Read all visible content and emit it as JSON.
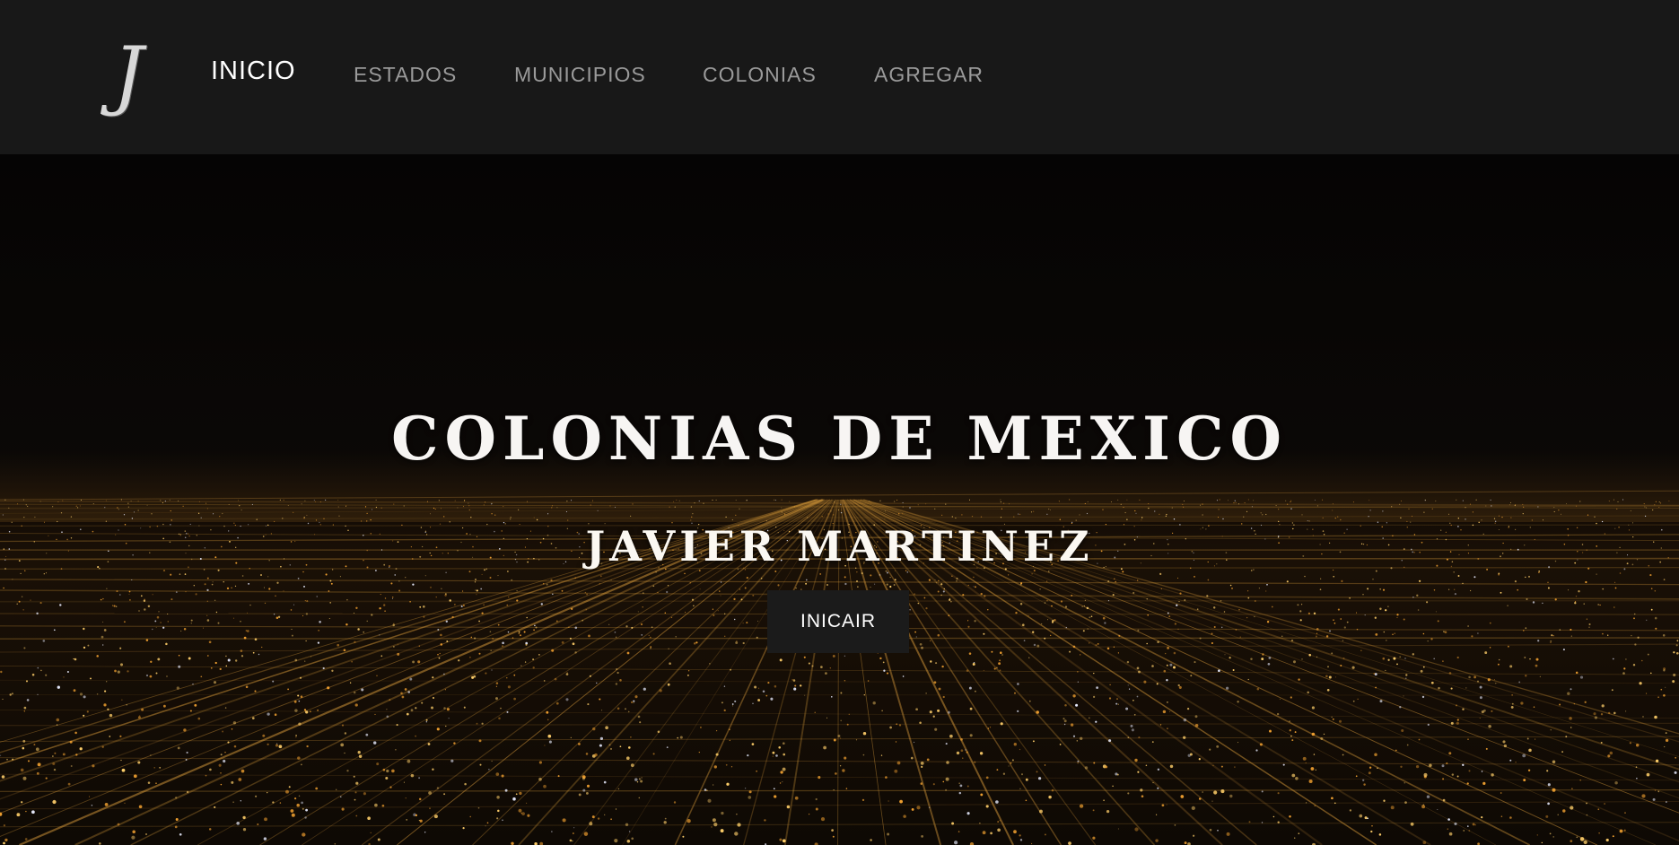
{
  "navbar": {
    "logo_text": "J",
    "items": [
      {
        "label": "INICIO",
        "active": true
      },
      {
        "label": "ESTADOS",
        "active": false
      },
      {
        "label": "MUNICIPIOS",
        "active": false
      },
      {
        "label": "COLONIAS",
        "active": false
      },
      {
        "label": "AGREGAR",
        "active": false
      }
    ]
  },
  "hero": {
    "title": "COLONIAS DE MEXICO",
    "subtitle": "JAVIER MARTINEZ",
    "button_label": "INICAIR"
  },
  "colors": {
    "navbar_bg": "#181818",
    "nav_active": "#ffffff",
    "nav_inactive": "#9a9a9a",
    "button_bg": "#1b1b1b",
    "city_lights": "#f5b042"
  }
}
